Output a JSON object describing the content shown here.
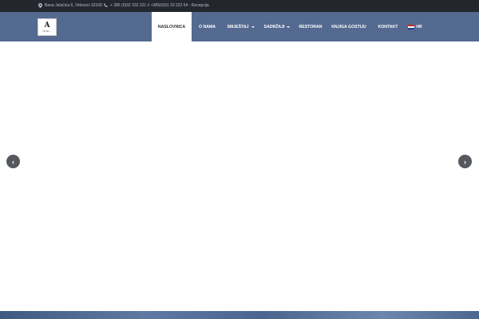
{
  "topbar": {
    "address": "Bana Jelačića 6, Vinkovci 32100",
    "phone": "+ 385 (0)32 332 221 // +385(0)91 33 222 54 - Recepcija",
    "address_icon": "map-pin-icon",
    "phone_icon": "phone-icon"
  },
  "logo": {
    "mark": "A",
    "text": "HOTEL ..."
  },
  "menu": {
    "items": [
      {
        "label": "NASLOVNICA"
      },
      {
        "label": "O NAMA"
      },
      {
        "label": "SMJEŠTAJ"
      },
      {
        "label": "SADRŽAJI"
      },
      {
        "label": "RESTORAN"
      },
      {
        "label": "KNJIGA GOSTIJU"
      },
      {
        "label": "KONTAKT"
      },
      {
        "label": "HR"
      }
    ]
  },
  "slider": {
    "prev_label": "‹",
    "next_label": "›"
  },
  "colors": {
    "topbar_bg": "#23262d",
    "nav_bg": "#52688f",
    "active_bg": "#ffffff",
    "arrow_bg": "#55585d"
  }
}
